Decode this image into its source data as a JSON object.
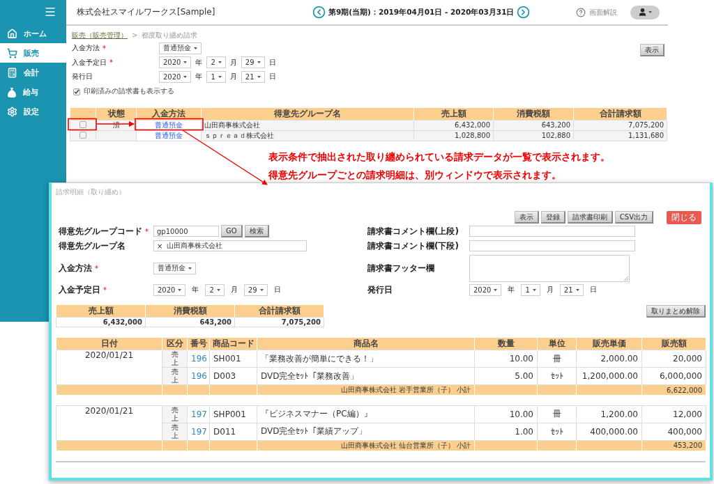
{
  "sidebar": {
    "items": [
      {
        "label": "ホーム",
        "selected": false
      },
      {
        "label": "販売",
        "selected": true
      },
      {
        "label": "会計",
        "selected": false
      },
      {
        "label": "給与",
        "selected": false
      },
      {
        "label": "設定",
        "selected": false
      }
    ]
  },
  "header": {
    "company": "株式会社スマイルワークス[Sample]",
    "period": "第9期(当期)：2019年04月01日 - 2020年03月31日",
    "help": "画面解説"
  },
  "breadcrumb": {
    "link": "販売（販売管理）",
    "separator": ">",
    "current": "都度取り纏め請求"
  },
  "filters": {
    "payment": {
      "label": "入金方法",
      "required_mark": "*",
      "value": "普通預金"
    },
    "dates": [
      {
        "label": "入金予定日",
        "required_mark": "*",
        "parts": [
          {
            "value": "2020",
            "unit": "年"
          },
          {
            "value": "2",
            "unit": "月"
          },
          {
            "value": "29",
            "unit": "日"
          }
        ]
      },
      {
        "label": "発行日",
        "parts": [
          {
            "value": "2020",
            "unit": "年"
          },
          {
            "value": "1",
            "unit": "月"
          },
          {
            "value": "21",
            "unit": "日"
          }
        ]
      }
    ],
    "show_printed": {
      "label": "印刷済みの請求書も表示する",
      "checked": true
    },
    "display_button": "表示"
  },
  "invoice_list": {
    "columns": [
      "状態",
      "入金方法",
      "得意先グループ名",
      "売上額",
      "消費税額",
      "合計請求額"
    ],
    "rows": [
      {
        "checked": false,
        "status": "済",
        "payment_method": "普通預金",
        "group": "山田商事株式会社",
        "sales": "6,432,000",
        "tax": "643,200",
        "total": "7,075,200"
      },
      {
        "checked": false,
        "payment_method": "普通預金",
        "group": "ｓｐｒｅａｄ株式会社",
        "sales": "1,028,800",
        "tax": "102,880",
        "total": "1,131,680"
      }
    ]
  },
  "annotation": {
    "lines": [
      "表示条件で抽出された取り纏められている請求データが一覧で表示されます。",
      "得意先グループごとの請求明細は、別ウィンドウで表示されます。"
    ]
  },
  "detail_window": {
    "title": "請求明細（取り纏め）",
    "buttons": [
      {
        "label": "表示",
        "kind": "default"
      },
      {
        "label": "登録",
        "kind": "default"
      },
      {
        "label": "請求書印刷",
        "kind": "default"
      },
      {
        "label": "CSV出力",
        "kind": "default"
      },
      {
        "label": "閉じる",
        "kind": "danger"
      }
    ],
    "form_rows": [
      {
        "left": {
          "label": "得意先グループコード",
          "required_mark": "*",
          "kind": "code",
          "value": "gp10000",
          "buttons": [
            "GO",
            "検索"
          ]
        },
        "right": {
          "label": "請求書コメント欄(上段)",
          "kind": "text"
        }
      },
      {
        "left": {
          "label": "得意先グループ名",
          "kind": "name",
          "clear_mark": "×",
          "value": "山田商事株式会社"
        },
        "right": {
          "label": "請求書コメント欄(下段)",
          "kind": "text"
        }
      },
      {
        "left": {
          "label": "入金方法",
          "required_mark": "*",
          "kind": "select",
          "value": "普通預金"
        },
        "right": {
          "label": "請求書フッター欄",
          "kind": "textarea"
        }
      },
      {
        "left": {
          "label": "入金予定日",
          "required_mark": "*",
          "kind": "date",
          "parts": [
            {
              "value": "2020",
              "unit": "年"
            },
            {
              "value": "2",
              "unit": "月"
            },
            {
              "value": "29",
              "unit": "日"
            }
          ]
        },
        "right": {
          "label": "発行日",
          "kind": "date",
          "parts": [
            {
              "value": "2020",
              "unit": "年"
            },
            {
              "value": "1",
              "unit": "月"
            },
            {
              "value": "21",
              "unit": "日"
            }
          ]
        }
      }
    ],
    "summary": {
      "columns": [
        "売上額",
        "消費税額",
        "合計請求額"
      ],
      "values": [
        "6,432,000",
        "643,200",
        "7,075,200"
      ]
    },
    "release_button": "取りまとめ解除",
    "table": {
      "columns": [
        "日付",
        "区分",
        "番号",
        "商品コード",
        "商品名",
        "数量",
        "単位",
        "販売単価",
        "販売額"
      ],
      "groups": [
        {
          "date": "2020/01/21",
          "rows": [
            {
              "type": "売上",
              "number": "196",
              "code": "SH001",
              "name": "「業務改善が簡単にできる！」",
              "qty": "10.00",
              "unit": "冊",
              "price": "2,000.00",
              "amount": "20,000"
            },
            {
              "type": "売上",
              "number": "196",
              "code": "D003",
              "name": "DVD完全ｾｯﾄ「業務改善」",
              "qty": "5.00",
              "unit": "ｾｯﾄ",
              "price": "1,200,000.00",
              "amount": "6,000,000"
            }
          ],
          "subtotal_label": "山田商事株式会社 岩手営業所（子） 小計",
          "subtotal": "6,622,000"
        },
        {
          "date": "2020/01/21",
          "rows": [
            {
              "type": "売上",
              "number": "197",
              "code": "SHP001",
              "name": "『ビジネスマナー（PC編）』",
              "qty": "10.00",
              "unit": "冊",
              "price": "1,200.00",
              "amount": "12,000"
            },
            {
              "type": "売上",
              "number": "197",
              "code": "D011",
              "name": "DVD完全ｾｯﾄ「業績アップ」",
              "qty": "1.00",
              "unit": "ｾｯﾄ",
              "price": "400,000.00",
              "amount": "400,000"
            }
          ],
          "subtotal_label": "山田商事株式会社 仙台営業所（子） 小計",
          "subtotal": "453,200"
        }
      ]
    }
  }
}
